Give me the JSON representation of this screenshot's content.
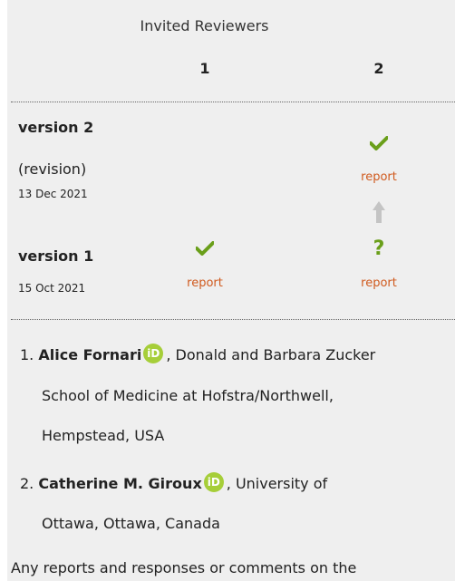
{
  "header": {
    "title": "Invited Reviewers",
    "columns": [
      "1",
      "2"
    ]
  },
  "versions": [
    {
      "label": "version 2",
      "sub": "(revision)",
      "date": "13 Dec 2021",
      "reviews": [
        {
          "status": "none"
        },
        {
          "status": "approved",
          "link": "report"
        }
      ]
    },
    {
      "label": "version 1",
      "date": "15 Oct 2021",
      "reviews": [
        {
          "status": "approved",
          "link": "report"
        },
        {
          "status": "approved-with-reservations",
          "symbol": "?",
          "link": "report"
        }
      ]
    }
  ],
  "reviewers": [
    {
      "num": "1.",
      "name": "Alice Fornari",
      "affiliation_line1": ", Donald and Barbara Zucker",
      "affiliation_line2": "School of Medicine at Hofstra/Northwell,",
      "affiliation_line3": "Hempstead, USA"
    },
    {
      "num": "2.",
      "name": "Catherine M. Giroux",
      "affiliation_line1": ", University of",
      "affiliation_line2": "Ottawa, Ottawa, Canada"
    }
  ],
  "orcid_label": "iD",
  "footer": "Any reports and responses or comments on the",
  "colors": {
    "check": "#6a9f1a",
    "link": "#d05a1e",
    "arrow": "#c4c4c4",
    "orcid": "#a6ce39"
  }
}
